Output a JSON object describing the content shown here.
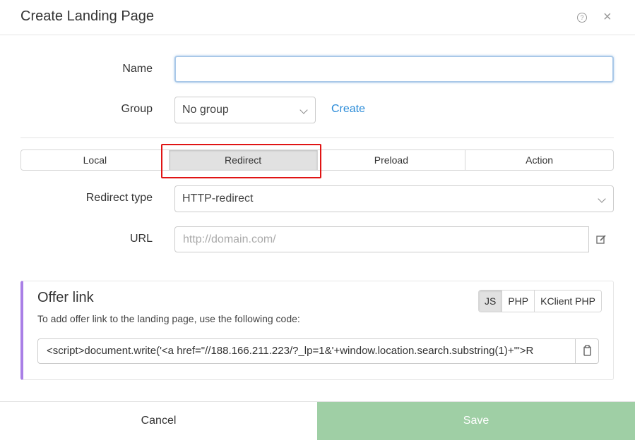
{
  "dialog": {
    "title": "Create Landing Page",
    "help_glyph": "?",
    "close_glyph": "×"
  },
  "form": {
    "name_label": "Name",
    "name_value": "",
    "group_label": "Group",
    "group_value": "No group",
    "create_link": "Create"
  },
  "tabs": [
    {
      "label": "Local",
      "active": false
    },
    {
      "label": "Redirect",
      "active": true
    },
    {
      "label": "Preload",
      "active": false
    },
    {
      "label": "Action",
      "active": false
    }
  ],
  "redirect": {
    "type_label": "Redirect type",
    "type_value": "HTTP-redirect",
    "url_label": "URL",
    "url_placeholder": "http://domain.com/"
  },
  "offer": {
    "title": "Offer link",
    "description": "To add offer link to the landing page, use the following code:",
    "languages": [
      {
        "label": "JS",
        "active": true
      },
      {
        "label": "PHP",
        "active": false
      },
      {
        "label": "KClient PHP",
        "active": false
      }
    ],
    "code": "<script>document.write('<a href=\"//188.166.211.223/?_lp=1&'+window.location.search.substring(1)+'\">R"
  },
  "footer": {
    "cancel_label": "Cancel",
    "save_label": "Save"
  },
  "colors": {
    "accent_link": "#2a8bd8",
    "save_button": "#9fcfa5",
    "offer_border": "#a97fe6",
    "highlight": "#e01414"
  },
  "icons": {
    "help": "help-icon",
    "close": "close-icon",
    "edit": "edit-icon",
    "copy": "copy-icon",
    "chevron": "chevron-down-icon"
  }
}
